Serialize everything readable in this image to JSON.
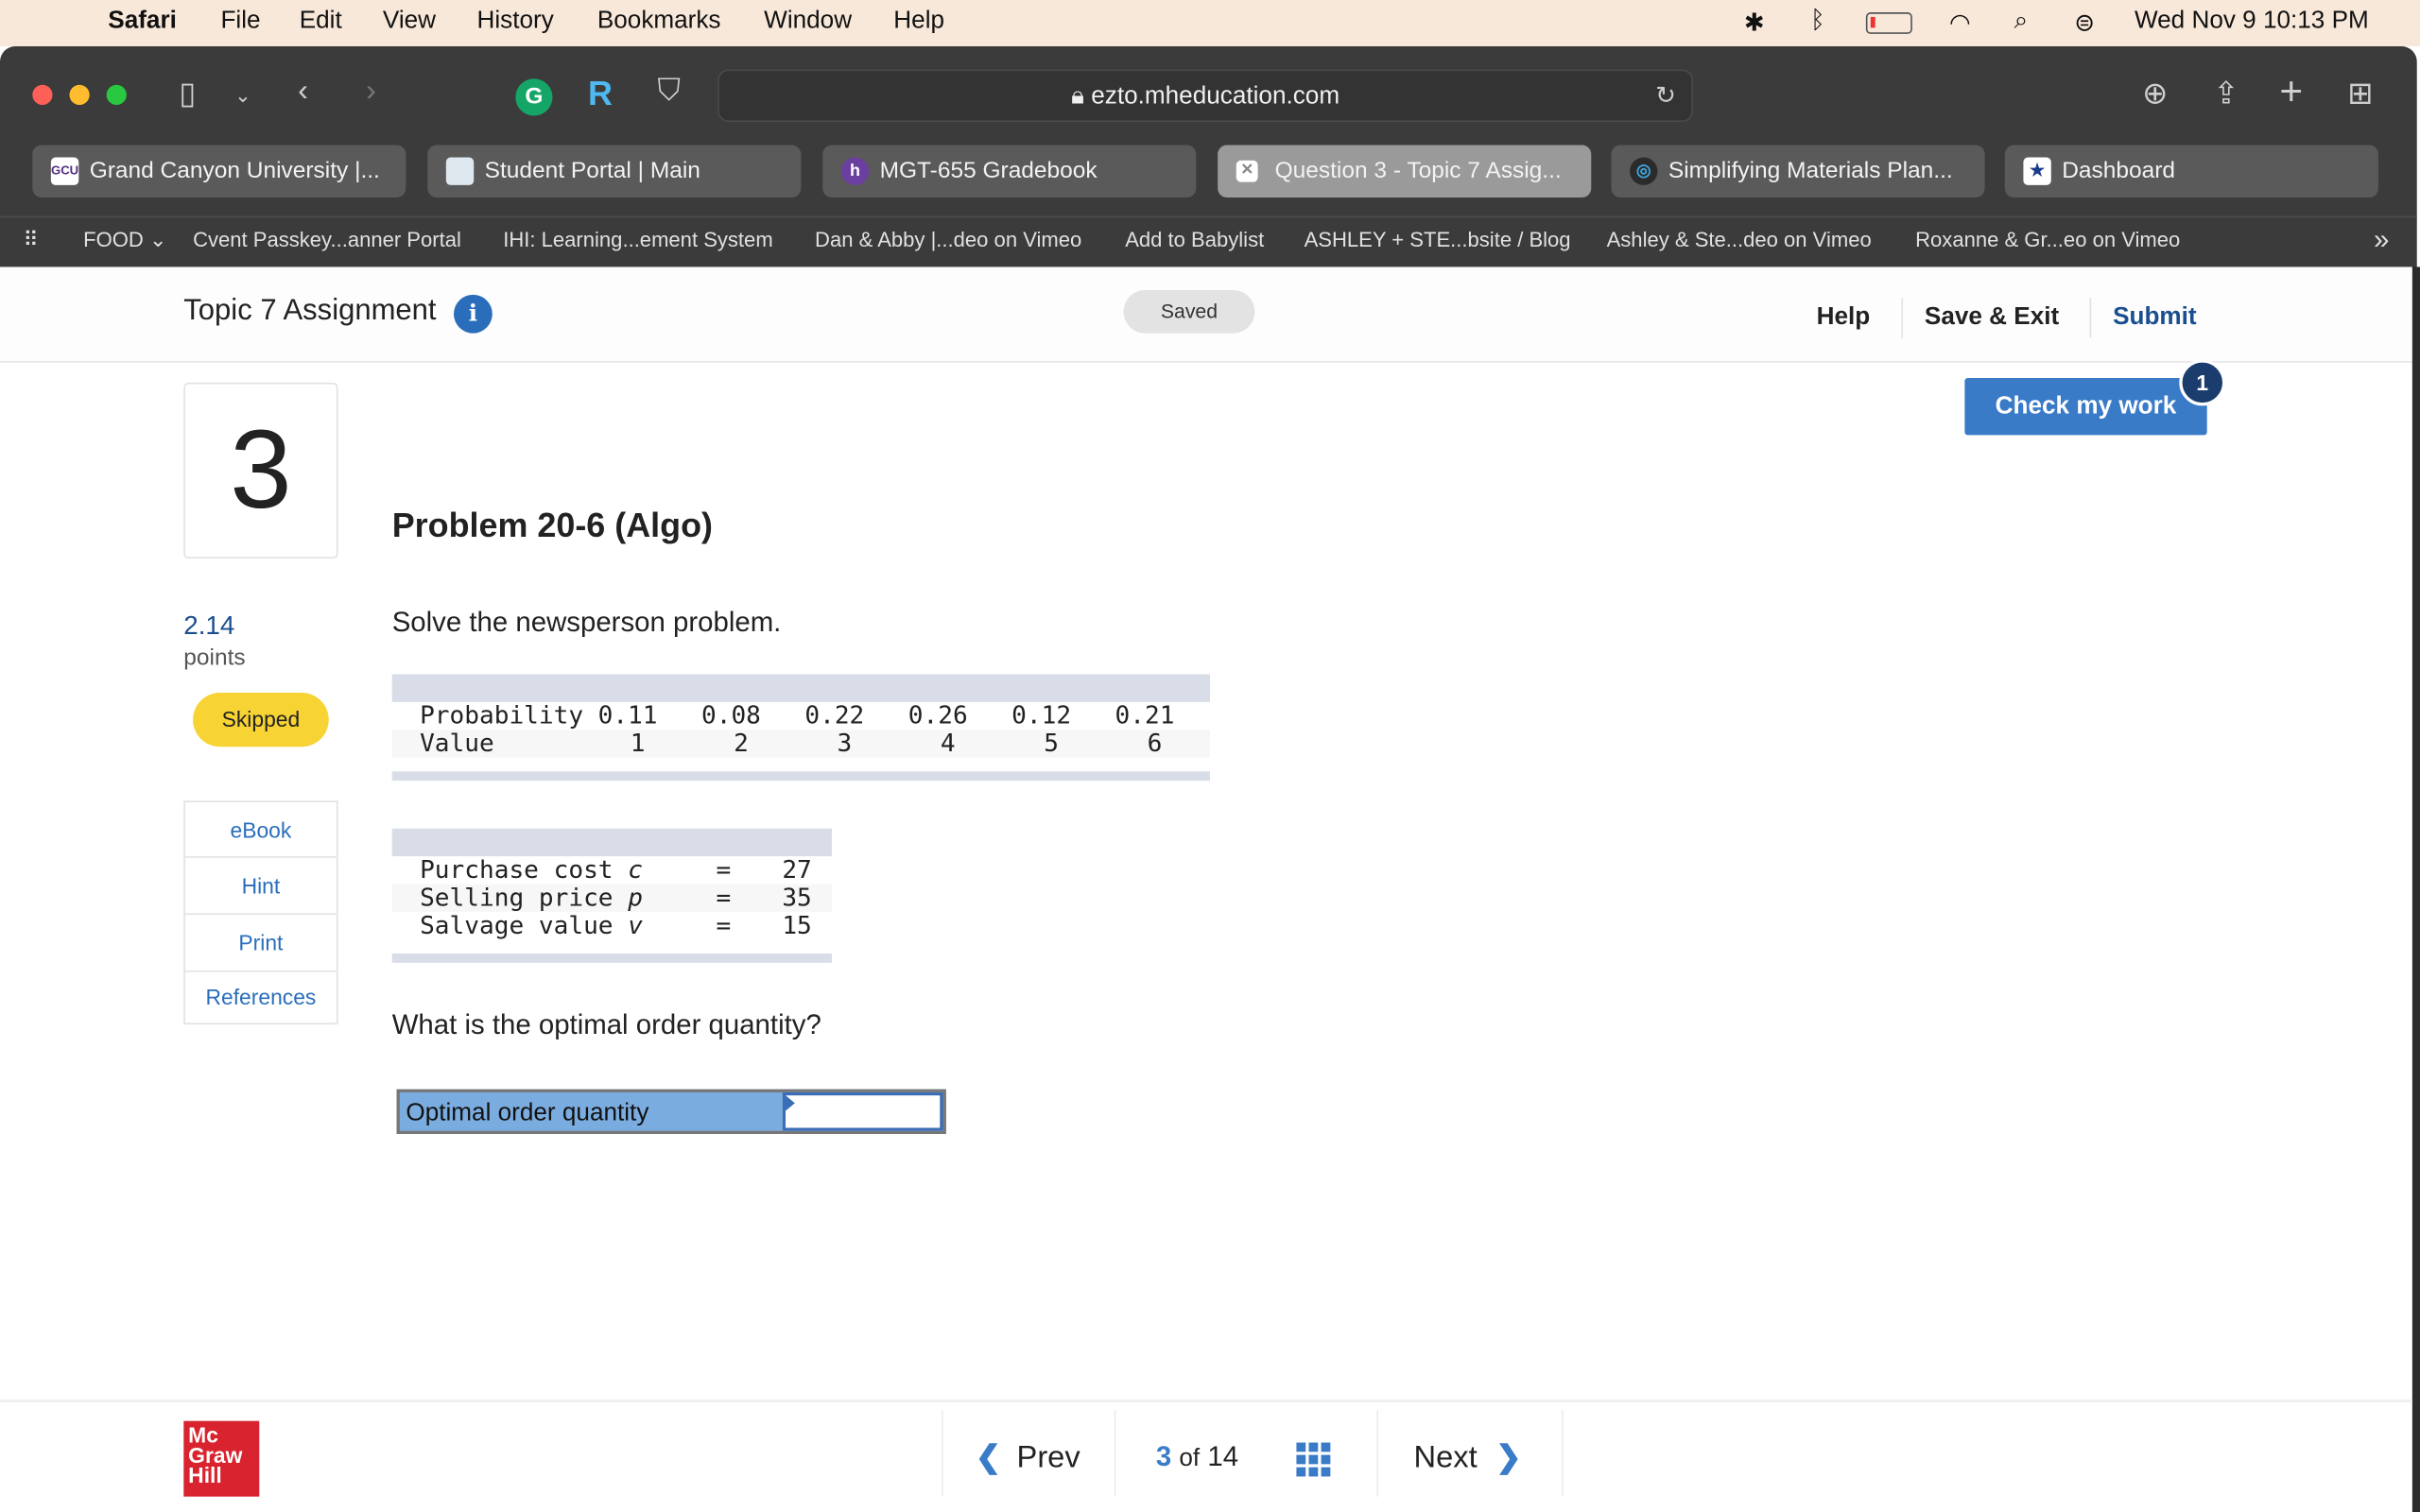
{
  "menubar": {
    "apple": "",
    "app": "Safari",
    "items": [
      "File",
      "Edit",
      "View",
      "History",
      "Bookmarks",
      "Window",
      "Help"
    ],
    "clock": "Wed Nov 9  10:13 PM",
    "status_icons": [
      "brightness-icon",
      "bluetooth-icon",
      "battery-icon",
      "wifi-icon",
      "search-icon",
      "control-center-icon"
    ]
  },
  "browser": {
    "url": "ezto.mheducation.com",
    "tabs": [
      {
        "label": "Grand Canyon University |...",
        "fav": "GCU"
      },
      {
        "label": "Student Portal | Main",
        "fav": ""
      },
      {
        "label": "MGT-655 Gradebook",
        "fav": "h"
      },
      {
        "label": "Question 3 - Topic 7 Assig...",
        "fav": "✕",
        "active": true
      },
      {
        "label": "Simplifying Materials Plan...",
        "fav": "◎"
      },
      {
        "label": "Dashboard",
        "fav": "★"
      }
    ],
    "bookmarks": [
      "FOOD ⌄",
      "Cvent Passkey...anner Portal",
      "IHI: Learning...ement System",
      "Dan & Abby |...deo on Vimeo",
      "Add to Babylist",
      "ASHLEY + STE...bsite / Blog",
      "Ashley & Ste...deo on Vimeo",
      "Roxanne & Gr...eo on Vimeo"
    ]
  },
  "header": {
    "title": "Topic 7 Assignment",
    "status": "Saved",
    "help": "Help",
    "save_exit": "Save & Exit",
    "submit": "Submit"
  },
  "check": {
    "label": "Check my work",
    "badge": "1"
  },
  "question": {
    "number": "3",
    "points": "2.14",
    "points_label": "points",
    "status": "Skipped",
    "title": "Problem 20-6 (Algo)",
    "prompt": "Solve the newsperson problem.",
    "ask": "What is the optimal order quantity?"
  },
  "side_links": [
    "eBook",
    "Hint",
    "Print",
    "References"
  ],
  "table1": {
    "rows": [
      {
        "label": "Probability",
        "values": [
          "0.11",
          "0.08",
          "0.22",
          "0.26",
          "0.12",
          "0.21"
        ]
      },
      {
        "label": "Value",
        "values": [
          "1",
          "2",
          "3",
          "4",
          "5",
          "6"
        ]
      }
    ]
  },
  "table2": {
    "rows": [
      {
        "label": "Purchase cost ",
        "var": "c",
        "eq": "=",
        "value": "27"
      },
      {
        "label": "Selling price ",
        "var": "p",
        "eq": "=",
        "value": "35"
      },
      {
        "label": "Salvage value ",
        "var": "v",
        "eq": "=",
        "value": "15"
      }
    ]
  },
  "answer": {
    "label": "Optimal order quantity",
    "value": ""
  },
  "footer": {
    "logo": "Mc Graw Hill",
    "prev": "Prev",
    "current": "3",
    "of": "of",
    "total": "14",
    "next": "Next"
  },
  "colors": {
    "accent": "#2a6ebb",
    "skipped": "#f7d334",
    "logo": "#d9232e",
    "input_label": "#7aacdf"
  }
}
